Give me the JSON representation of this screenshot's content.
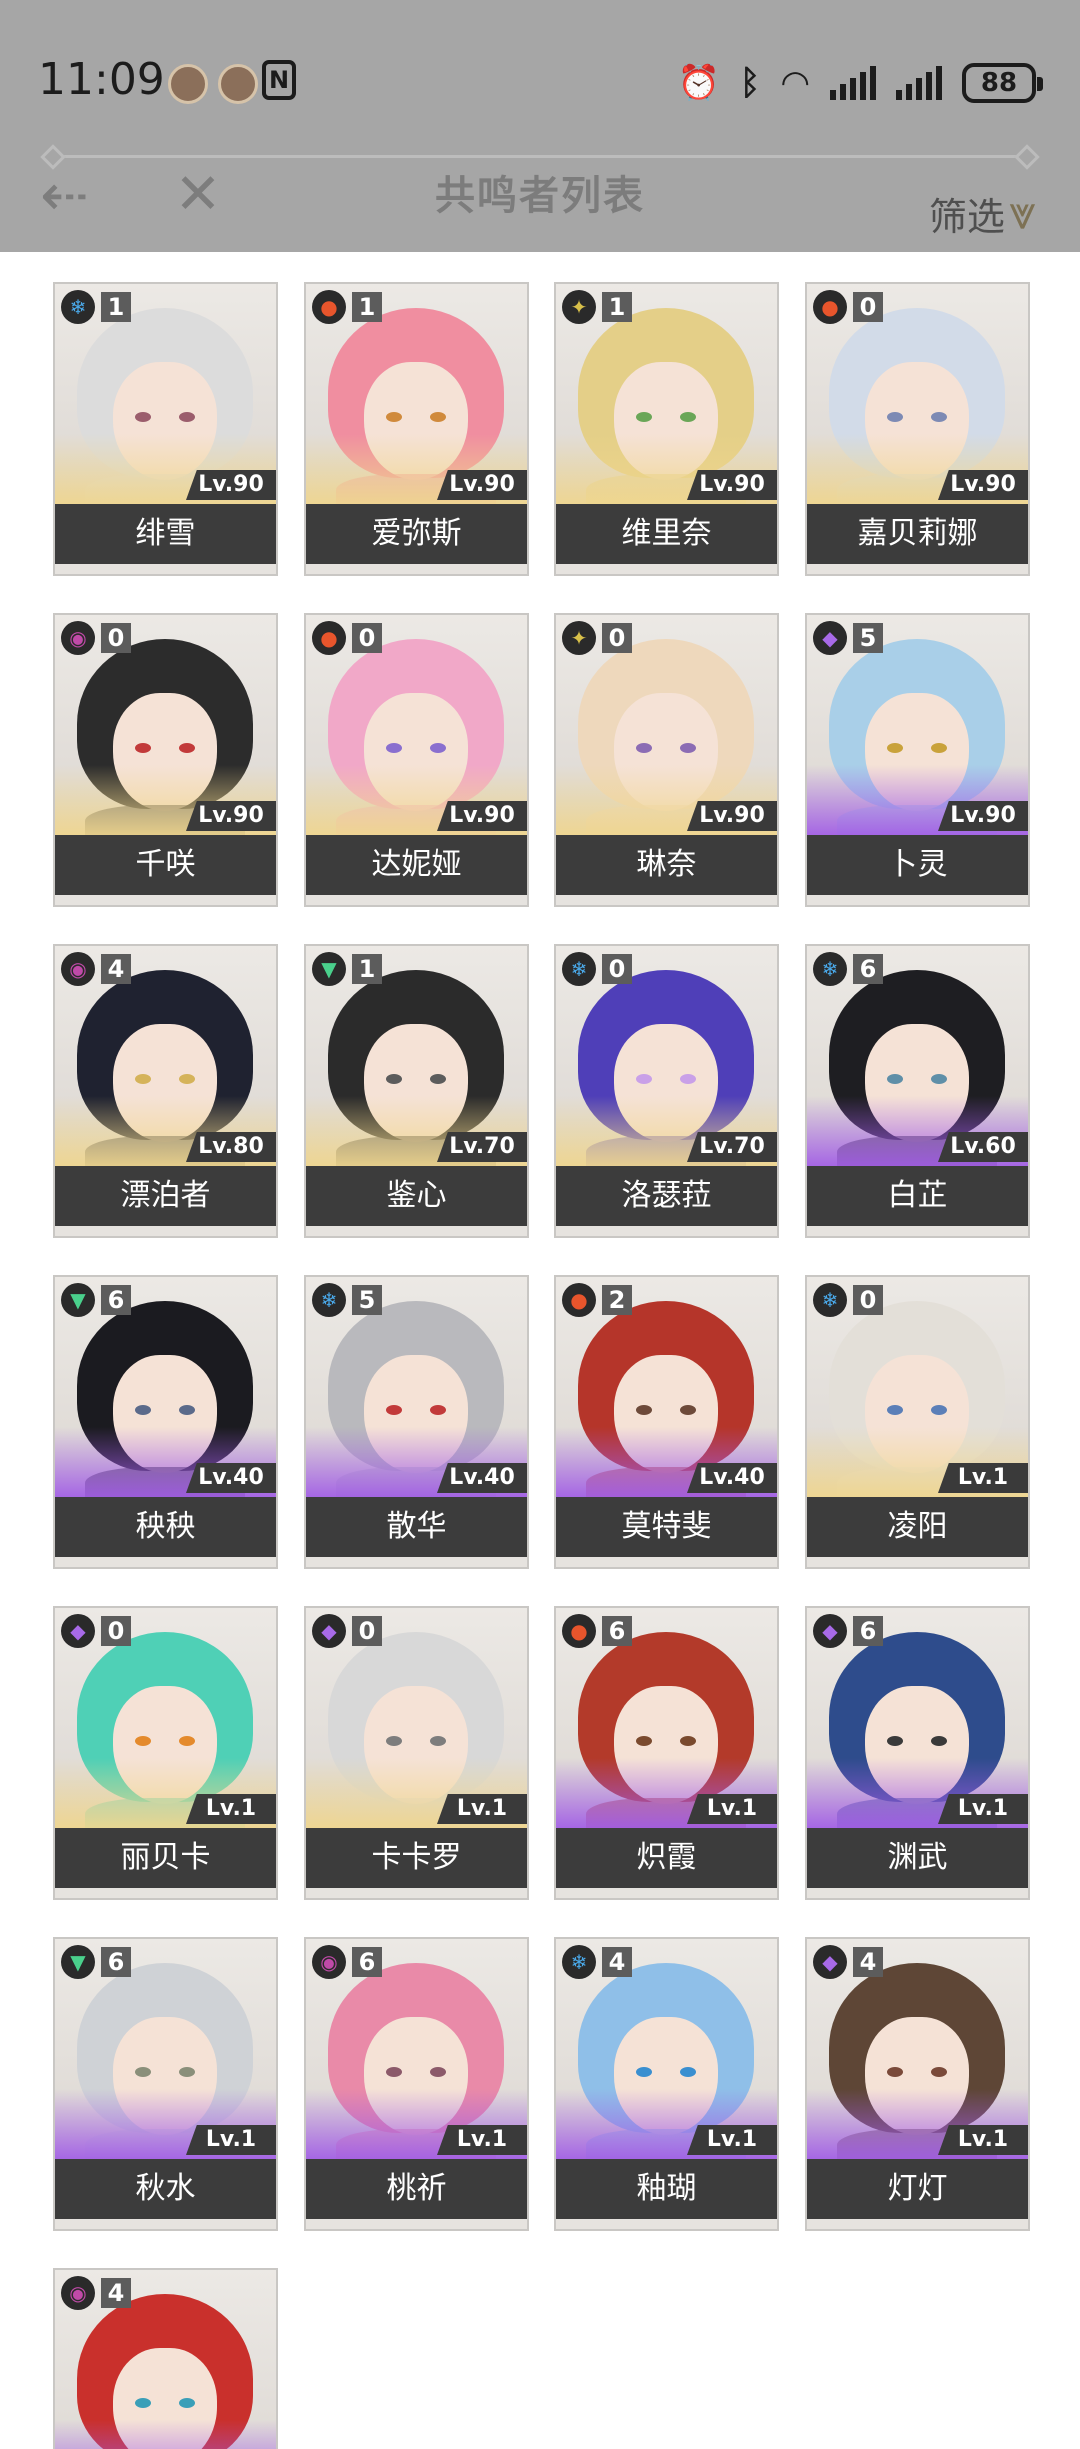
{
  "status_bar": {
    "time": "11:09",
    "battery": "88",
    "nfc": "N"
  },
  "header": {
    "title": "共鸣者列表",
    "filter_label": "筛选"
  },
  "characters": [
    {
      "name": "绯雪",
      "level": "Lv.90",
      "sequence": "1",
      "element": "glacio",
      "quality": 5,
      "hair": "#dcdcdc",
      "eyes": "#9b5d6c"
    },
    {
      "name": "爱弥斯",
      "level": "Lv.90",
      "sequence": "1",
      "element": "fusion",
      "quality": 5,
      "hair": "#f08ea0",
      "eyes": "#d08a3c"
    },
    {
      "name": "维里奈",
      "level": "Lv.90",
      "sequence": "1",
      "element": "spectro",
      "quality": 5,
      "hair": "#e4cf88",
      "eyes": "#6aa657"
    },
    {
      "name": "嘉贝莉娜",
      "level": "Lv.90",
      "sequence": "0",
      "element": "fusion",
      "quality": 5,
      "hair": "#d2dbe8",
      "eyes": "#7d8ab4"
    },
    {
      "name": "千咲",
      "level": "Lv.90",
      "sequence": "0",
      "element": "havoc",
      "quality": 5,
      "hair": "#2c2c2c",
      "eyes": "#c23a3a"
    },
    {
      "name": "达妮娅",
      "level": "Lv.90",
      "sequence": "0",
      "element": "fusion",
      "quality": 5,
      "hair": "#f1a8c8",
      "eyes": "#8a6fcf"
    },
    {
      "name": "琳奈",
      "level": "Lv.90",
      "sequence": "0",
      "element": "spectro",
      "quality": 5,
      "hair": "#eed8bc",
      "eyes": "#8c6cb4"
    },
    {
      "name": "卜灵",
      "level": "Lv.90",
      "sequence": "5",
      "element": "electro",
      "quality": 4,
      "hair": "#a9cfe8",
      "eyes": "#c9a23b"
    },
    {
      "name": "漂泊者",
      "level": "Lv.80",
      "sequence": "4",
      "element": "havoc",
      "quality": 5,
      "hair": "#1f2230",
      "eyes": "#d5b35a"
    },
    {
      "name": "鉴心",
      "level": "Lv.70",
      "sequence": "1",
      "element": "aero",
      "quality": 5,
      "hair": "#2b2b2b",
      "eyes": "#5c5c5c"
    },
    {
      "name": "洛瑟菈",
      "level": "Lv.70",
      "sequence": "0",
      "element": "glacio",
      "quality": 5,
      "hair": "#4f3fb8",
      "eyes": "#c9a0e8"
    },
    {
      "name": "白芷",
      "level": "Lv.60",
      "sequence": "6",
      "element": "glacio",
      "quality": 4,
      "hair": "#1e1e22",
      "eyes": "#5f8fa8"
    },
    {
      "name": "秧秧",
      "level": "Lv.40",
      "sequence": "6",
      "element": "aero",
      "quality": 4,
      "hair": "#1b1b20",
      "eyes": "#5b6a8a"
    },
    {
      "name": "散华",
      "level": "Lv.40",
      "sequence": "5",
      "element": "glacio",
      "quality": 4,
      "hair": "#b9b9bd",
      "eyes": "#c23a3a"
    },
    {
      "name": "莫特斐",
      "level": "Lv.40",
      "sequence": "2",
      "element": "fusion",
      "quality": 4,
      "hair": "#b5352a",
      "eyes": "#6d4a3a"
    },
    {
      "name": "凌阳",
      "level": "Lv.1",
      "sequence": "0",
      "element": "glacio",
      "quality": 5,
      "hair": "#e3dfd8",
      "eyes": "#5b7fb8"
    },
    {
      "name": "丽贝卡",
      "level": "Lv.1",
      "sequence": "0",
      "element": "electro",
      "quality": 5,
      "hair": "#4fd0b6",
      "eyes": "#e48a2c"
    },
    {
      "name": "卡卡罗",
      "level": "Lv.1",
      "sequence": "0",
      "element": "electro",
      "quality": 5,
      "hair": "#d8d8d8",
      "eyes": "#7d7d7d"
    },
    {
      "name": "炽霞",
      "level": "Lv.1",
      "sequence": "6",
      "element": "fusion",
      "quality": 4,
      "hair": "#b33a2a",
      "eyes": "#7a4a2e"
    },
    {
      "name": "渊武",
      "level": "Lv.1",
      "sequence": "6",
      "element": "electro",
      "quality": 4,
      "hair": "#2e4c8c",
      "eyes": "#3a3a3a"
    },
    {
      "name": "秋水",
      "level": "Lv.1",
      "sequence": "6",
      "element": "aero",
      "quality": 4,
      "hair": "#cfd2d6",
      "eyes": "#8a8f7a"
    },
    {
      "name": "桃祈",
      "level": "Lv.1",
      "sequence": "6",
      "element": "havoc",
      "quality": 4,
      "hair": "#e98aa8",
      "eyes": "#8c5a6a"
    },
    {
      "name": "釉瑚",
      "level": "Lv.1",
      "sequence": "4",
      "element": "glacio",
      "quality": 4,
      "hair": "#8fbfe8",
      "eyes": "#3a8fd0"
    },
    {
      "name": "灯灯",
      "level": "Lv.1",
      "sequence": "4",
      "element": "electro",
      "quality": 4,
      "hair": "#5e4636",
      "eyes": "#7a4a3a"
    },
    {
      "name": "",
      "level": "",
      "sequence": "4",
      "element": "havoc",
      "quality": 4,
      "hair": "#c9302c",
      "eyes": "#3a9fb8"
    }
  ],
  "element_icons": {
    "glacio": {
      "glyph": "❄",
      "color": "#4aa8e8"
    },
    "fusion": {
      "glyph": "●",
      "color": "#e8552c"
    },
    "spectro": {
      "glyph": "✦",
      "color": "#d8c04a"
    },
    "havoc": {
      "glyph": "◉",
      "color": "#c04aa8"
    },
    "electro": {
      "glyph": "◆",
      "color": "#a86ae8"
    },
    "aero": {
      "glyph": "▼",
      "color": "#4ad08c"
    }
  }
}
